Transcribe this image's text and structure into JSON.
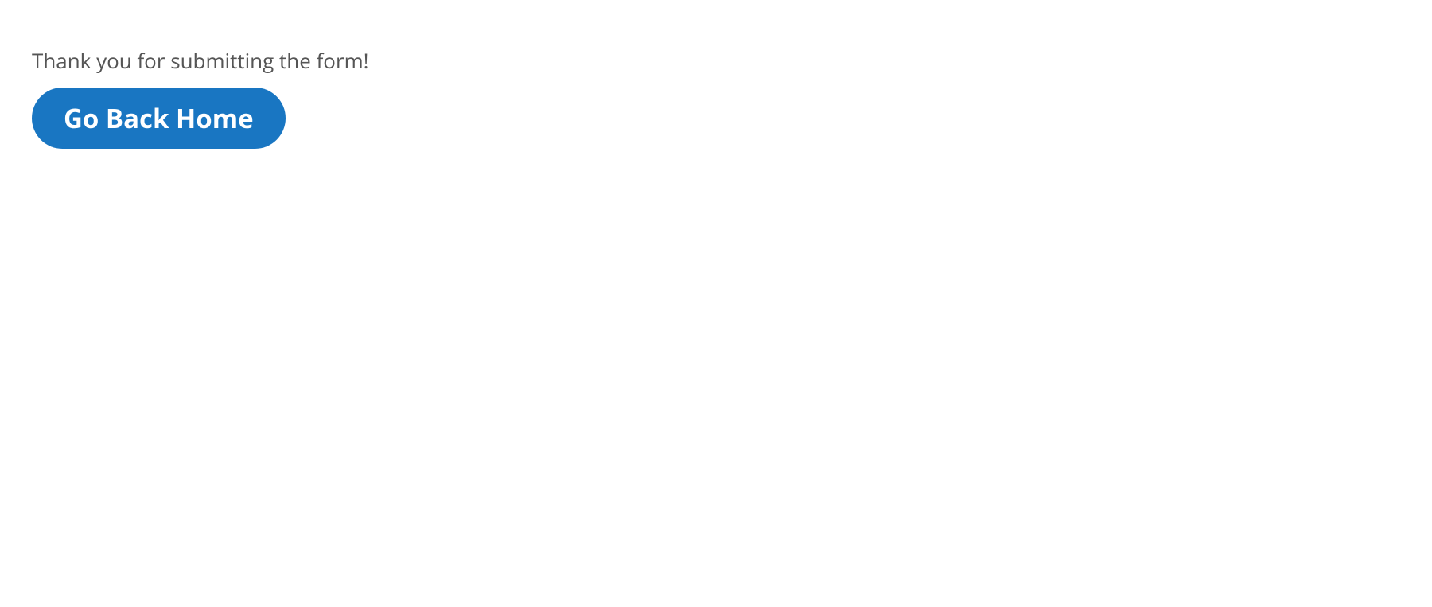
{
  "message": "Thank you for submitting the form!",
  "button_label": "Go Back Home"
}
